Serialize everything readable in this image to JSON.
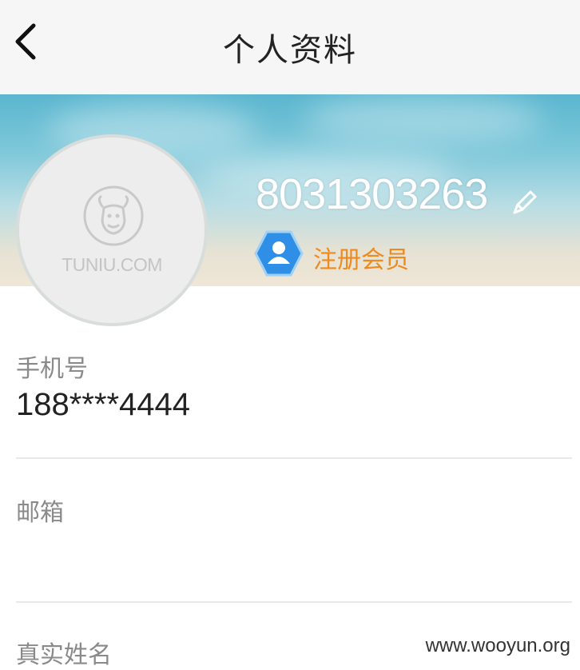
{
  "header": {
    "title": "个人资料",
    "back_icon": "chevron-left-icon"
  },
  "profile": {
    "avatar_text": "TUNIU.COM",
    "username": "8031303263",
    "edit_icon": "pencil-icon",
    "member_badge_icon": "user-hexagon-icon",
    "member_level": "注册会员",
    "member_color": "#ef8a1f",
    "badge_color": "#2f8ee6"
  },
  "fields": {
    "phone": {
      "label": "手机号",
      "value": "188****4444"
    },
    "email": {
      "label": "邮箱",
      "value": ""
    },
    "real_name": {
      "label": "真实姓名",
      "value": ""
    }
  },
  "watermark": "www.wooyun.org"
}
